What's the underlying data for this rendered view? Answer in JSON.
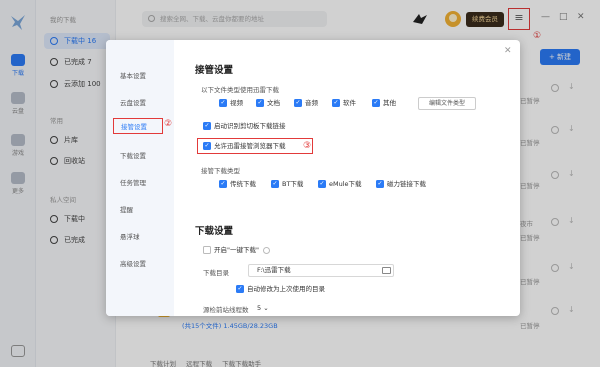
{
  "rail": {
    "items": [
      {
        "label": "下载"
      },
      {
        "label": "云盘"
      },
      {
        "label": "游戏"
      },
      {
        "label": "更多"
      }
    ]
  },
  "sidebar": {
    "section1": "我的下载",
    "downloading": "下载中",
    "downloading_count": "16",
    "completed": "已完成",
    "completed_count": "7",
    "cloud_add": "云添加",
    "cloud_add_count": "100",
    "section2": "常用",
    "tool1": "片库",
    "tool2": "回收站",
    "section3": "私人空间",
    "private1": "下载中",
    "private2": "已完成"
  },
  "topbar": {
    "search_placeholder": "搜索全网、下载、云盘你都要的地址",
    "vip_label": "续费会员",
    "menu_icon": "≡",
    "marker1": "①"
  },
  "background": {
    "new_button": "+ 新建",
    "paused": "已暂停",
    "row_text": "夜市",
    "footer_count": "(共15个文件) 1.45GB/28.23GB",
    "status_left": "下载计划",
    "status_mid": "远程下载",
    "status_right": "下载下载助手"
  },
  "dialog": {
    "nav": [
      "基本设置",
      "云盘设置",
      "接管设置",
      "下载设置",
      "任务管理",
      "提醒",
      "悬浮球",
      "高级设置"
    ],
    "marker2": "②",
    "section_title": "接管设置",
    "types_label": "以下文件类型使用迅雷下载",
    "file_types": [
      "视频",
      "文档",
      "音频",
      "软件",
      "其他"
    ],
    "edit_button": "编辑文件类型",
    "clipboard": "启动识别剪切板下载链接",
    "browser_takeover": "允许迅雷接管浏览器下载",
    "marker3": "③",
    "takeover_types_label": "接管下载类型",
    "takeover_types": [
      "传统下载",
      "BT下载",
      "eMule下载",
      "磁力链接下载"
    ],
    "download_title": "下载设置",
    "one_click": "开启\"一键下载\"",
    "dir_label": "下载目录",
    "dir_value": "F:\\迅雷下载",
    "auto_dir": "自动修改为上次使用的目录",
    "max_tasks_label": "源检前站线程数",
    "max_tasks_value": "5"
  },
  "colors": {
    "accent": "#2b7bf6",
    "marker_red": "#e23a3a"
  }
}
